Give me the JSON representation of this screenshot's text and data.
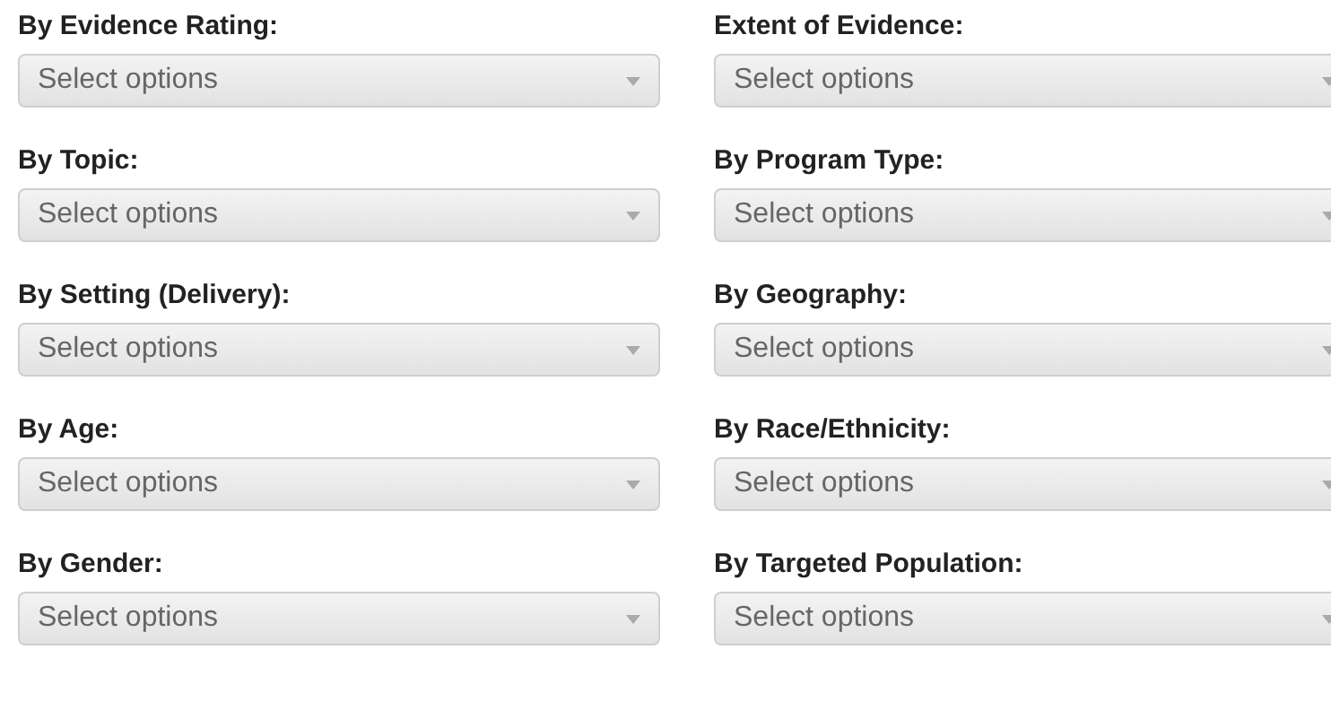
{
  "filters": [
    {
      "label": "By Evidence Rating:",
      "placeholder": "Select options"
    },
    {
      "label": "Extent of Evidence:",
      "placeholder": "Select options"
    },
    {
      "label": "By Topic:",
      "placeholder": "Select options"
    },
    {
      "label": "By Program Type:",
      "placeholder": "Select options"
    },
    {
      "label": "By Setting (Delivery):",
      "placeholder": "Select options"
    },
    {
      "label": "By Geography:",
      "placeholder": "Select options"
    },
    {
      "label": "By Age:",
      "placeholder": "Select options"
    },
    {
      "label": "By Race/Ethnicity:",
      "placeholder": "Select options"
    },
    {
      "label": "By Gender:",
      "placeholder": "Select options"
    },
    {
      "label": "By Targeted Population:",
      "placeholder": "Select options"
    }
  ]
}
